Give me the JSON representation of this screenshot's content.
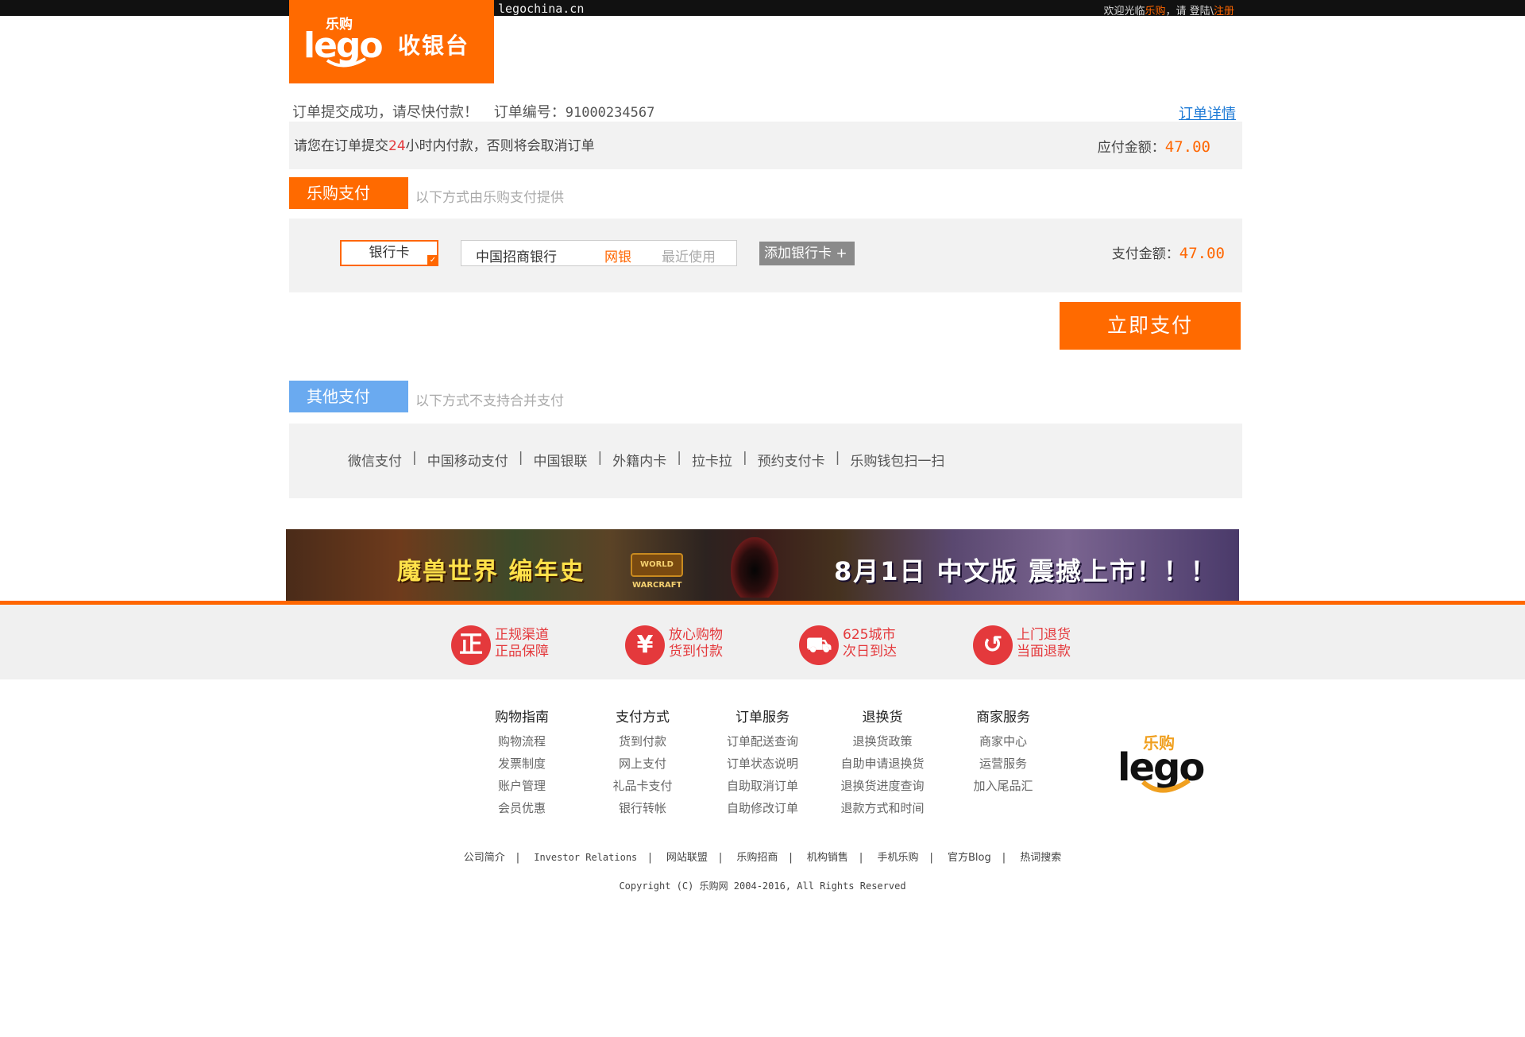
{
  "topbar": {
    "site_url": "legochina.cn",
    "welcome_prefix": "欢迎光临",
    "brand": "乐购",
    "welcome_mid": "，请 登陆\\",
    "register": "注册"
  },
  "header": {
    "logo_cn": "乐购",
    "logo_en": "lego",
    "title": "收银台"
  },
  "order": {
    "success_msg": "订单提交成功，请尽快付款！",
    "number_label": "订单编号：",
    "number": "91000234567",
    "detail_link": "订单详情",
    "notice_prefix": "请您在订单提交",
    "notice_hours": "24",
    "notice_suffix": "小时内付款，否则将会取消订单",
    "due_label": "应付金额：",
    "due_amount": "47.00"
  },
  "lego_pay": {
    "tab_label": "乐购支付",
    "note": "以下方式由乐购支付提供",
    "method_label": "银行卡",
    "bank_name": "中国招商银行",
    "bank_type": "网银",
    "bank_recent": "最近使用",
    "add_card": "添加银行卡 +",
    "pay_amount_label": "支付金额：",
    "pay_amount": "47.00",
    "pay_now": "立即支付"
  },
  "other_pay": {
    "tab_label": "其他支付",
    "note": "以下方式不支持合并支付",
    "methods": [
      "微信支付",
      "中国移动支付",
      "中国银联",
      "外籍内卡",
      "拉卡拉",
      "预约支付卡",
      "乐购钱包扫一扫"
    ]
  },
  "banner": {
    "left_text": "魔兽世界 编年史",
    "badge": "WORLD WARCRAFT",
    "right_text": "8月1日 中文版 震撼上市！！！"
  },
  "guarantees": [
    {
      "icon": "正",
      "line1": "正规渠道",
      "line2": "正品保障"
    },
    {
      "icon": "¥",
      "line1": "放心购物",
      "line2": "货到付款"
    },
    {
      "icon": "⛟",
      "line1": "625城市",
      "line2": "次日到达"
    },
    {
      "icon": "↺",
      "line1": "上门退货",
      "line2": "当面退款"
    }
  ],
  "footer_columns": [
    {
      "title": "购物指南",
      "links": [
        "购物流程",
        "发票制度",
        "账户管理",
        "会员优惠"
      ]
    },
    {
      "title": "支付方式",
      "links": [
        "货到付款",
        "网上支付",
        "礼品卡支付",
        "银行转帐"
      ]
    },
    {
      "title": "订单服务",
      "links": [
        "订单配送查询",
        "订单状态说明",
        "自助取消订单",
        "自助修改订单"
      ]
    },
    {
      "title": "退换货",
      "links": [
        "退换货政策",
        "自助申请退换货",
        "退换货进度查询",
        "退款方式和时间"
      ]
    },
    {
      "title": "商家服务",
      "links": [
        "商家中心",
        "运营服务",
        "加入尾品汇"
      ]
    }
  ],
  "footer_logo": {
    "cn": "乐购",
    "en": "lego"
  },
  "bottom_links": [
    "公司简介",
    "Investor Relations",
    "网站联盟",
    "乐购招商",
    "机构销售",
    "手机乐购",
    "官方Blog",
    "热词搜索"
  ],
  "copyright": "Copyright (C) 乐购网 2004-2016, All Rights Reserved",
  "colors": {
    "accent": "#ff6a00",
    "other_tab": "#6aaaf0",
    "guarantee_red": "#e4393c",
    "link_blue": "#1d7ad6"
  }
}
